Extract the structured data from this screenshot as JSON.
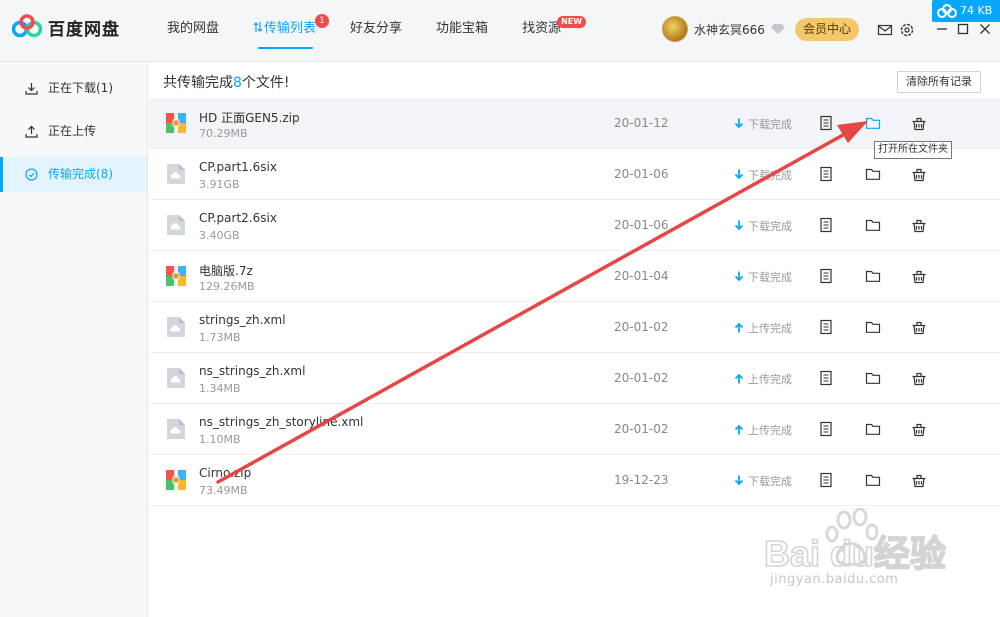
{
  "app": {
    "title": "百度网盘"
  },
  "nav": {
    "items": [
      {
        "label": "我的网盘",
        "active": false
      },
      {
        "label": "传输列表",
        "active": true,
        "badge": "1"
      },
      {
        "label": "好友分享",
        "active": false
      },
      {
        "label": "功能宝箱",
        "active": false
      },
      {
        "label": "找资源",
        "active": false,
        "badge_new": "NEW"
      }
    ]
  },
  "user": {
    "name": "水神玄冥666",
    "vip_label": "会员中心"
  },
  "speed": {
    "text": "74 KB"
  },
  "sidebar": {
    "items": [
      {
        "label": "正在下载(1)",
        "icon": "download-icon",
        "active": false
      },
      {
        "label": "正在上传",
        "icon": "upload-icon",
        "active": false
      },
      {
        "label": "传输完成(8)",
        "icon": "check-circle-icon",
        "active": true
      }
    ]
  },
  "summary": {
    "prefix": "共传输完成",
    "count": "8",
    "suffix": "个文件!"
  },
  "clear_all": "清除所有记录",
  "tooltip": "打开所在文件夹",
  "files": [
    {
      "name": "HD 正面GEN5.zip",
      "size": "70.29MB",
      "date": "20-01-12",
      "status": "下载完成",
      "direction": "down",
      "type": "zip"
    },
    {
      "name": "CP.part1.6six",
      "size": "3.91GB",
      "date": "20-01-06",
      "status": "下载完成",
      "direction": "down",
      "type": "generic"
    },
    {
      "name": "CP.part2.6six",
      "size": "3.40GB",
      "date": "20-01-06",
      "status": "下载完成",
      "direction": "down",
      "type": "generic"
    },
    {
      "name": "电脑版.7z",
      "size": "129.26MB",
      "date": "20-01-04",
      "status": "下载完成",
      "direction": "down",
      "type": "zip"
    },
    {
      "name": "strings_zh.xml",
      "size": "1.73MB",
      "date": "20-01-02",
      "status": "上传完成",
      "direction": "up",
      "type": "generic"
    },
    {
      "name": "ns_strings_zh.xml",
      "size": "1.34MB",
      "date": "20-01-02",
      "status": "上传完成",
      "direction": "up",
      "type": "generic"
    },
    {
      "name": "ns_strings_zh_storyline.xml",
      "size": "1.10MB",
      "date": "20-01-02",
      "status": "上传完成",
      "direction": "up",
      "type": "generic"
    },
    {
      "name": "Cirno.zip",
      "size": "73.49MB",
      "date": "19-12-23",
      "status": "下载完成",
      "direction": "down",
      "type": "zip"
    }
  ],
  "colors": {
    "accent": "#06a7ff",
    "arrow": "#e84545",
    "vip": "#f2c86a"
  },
  "watermark": {
    "brand": "Baidu经验",
    "url": "jingyan.baidu.com"
  }
}
